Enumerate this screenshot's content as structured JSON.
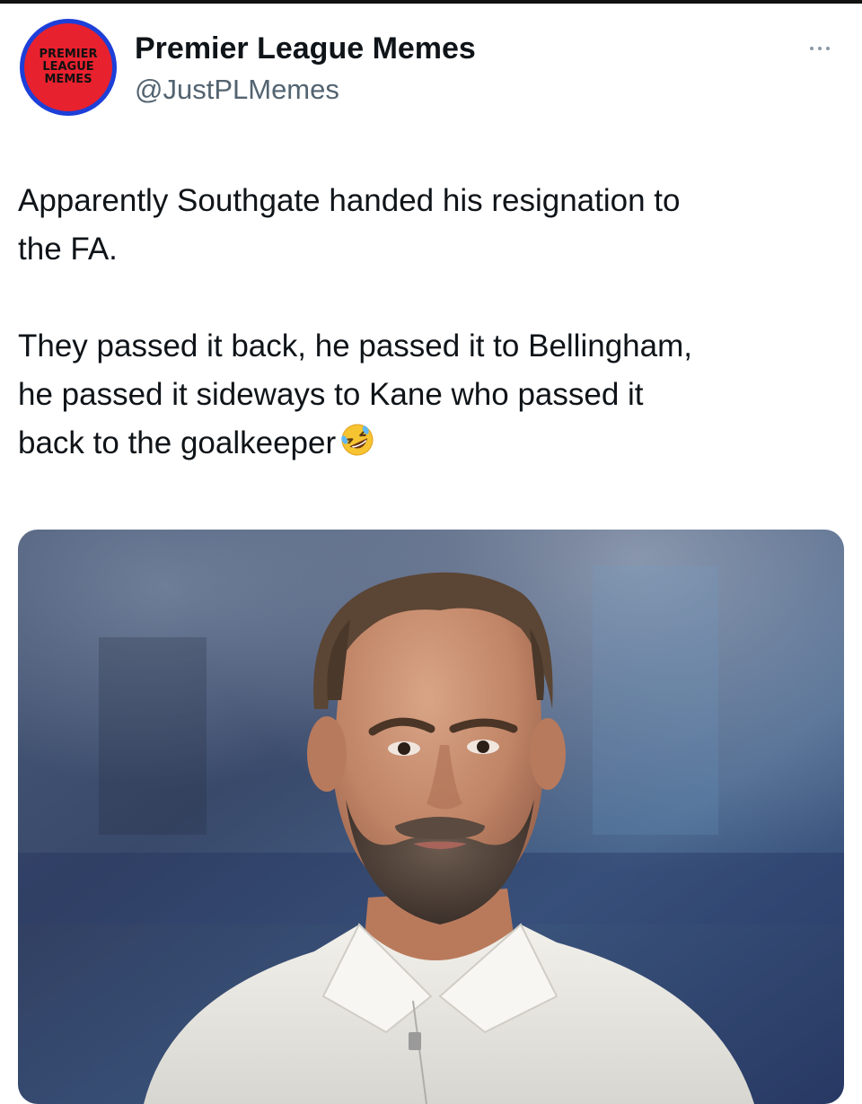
{
  "tweet": {
    "avatar": {
      "lines": [
        "PREMIER",
        "LEAGUE",
        "MEMES"
      ],
      "ring_color": "#1d3fd8",
      "fill_color": "#e8212e"
    },
    "display_name": "Premier League Memes",
    "handle": "@JustPLMemes",
    "more_icon": "more-horizontal-icon",
    "text": {
      "paragraph_1": "Apparently Southgate handed his resignation to\nthe FA.",
      "paragraph_2": "They passed it back, he passed it to Bellingham,\nhe passed it sideways to Kane who passed it\nback to the goalkeeper",
      "emoji": "rolling-on-the-floor-laughing-emoji"
    },
    "media": {
      "type": "photo",
      "subject": "man-portrait-photo"
    }
  }
}
